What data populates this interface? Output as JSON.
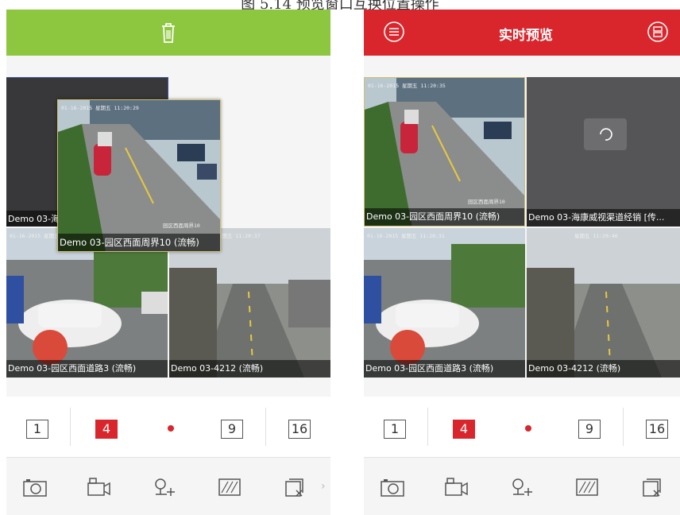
{
  "caption": "图 5.14 预览窗口互换位置操作",
  "colors": {
    "green_bar": "#8dc63f",
    "red_bar": "#d9262c",
    "active_layout": "#d9262c"
  },
  "left_screen": {
    "header": {
      "icon": "trash-icon"
    },
    "tiles": [
      {
        "label": "Demo 03-海",
        "timestamp": ""
      },
      {
        "label": "",
        "timestamp": "01-16-2015 星期五 11:20:37"
      },
      {
        "label": "Demo 03-园区西面道路3 (流畅)",
        "timestamp": "01-16-2015 星期五 11:20:37"
      },
      {
        "label": "Demo 03-4212 (流畅)",
        "timestamp": "星期五 11:20:37"
      }
    ],
    "dragged": {
      "label": "Demo 03-园区西面周界10 (流畅)",
      "timestamp": "01-16-2015 星期五 11:20:29",
      "overlay": "园区西面周界10"
    }
  },
  "right_screen": {
    "header": {
      "title": "实时预览",
      "menu_icon": "menu-icon",
      "list_icon": "list-icon"
    },
    "tiles": [
      {
        "label": "Demo 03-园区西面周界10 (流畅)",
        "timestamp": "01-16-2015 星期五 11:20:35",
        "overlay": "园区西面周界10"
      },
      {
        "label": "Demo 03-海康威视渠道经销 [传...",
        "timestamp": ""
      },
      {
        "label": "Demo 03-园区西面道路3 (流畅)",
        "timestamp": "01-16-2015 星期五 11:20:31"
      },
      {
        "label": "Demo 03-4212 (流畅)",
        "timestamp": "星期五 11:20:46"
      }
    ]
  },
  "layout_buttons": [
    "1",
    "4",
    "9",
    "16"
  ],
  "active_layout": "4",
  "toolbar_icons": [
    "camera-icon",
    "record-icon",
    "ptz-icon",
    "quality-icon",
    "close-all-icon"
  ]
}
